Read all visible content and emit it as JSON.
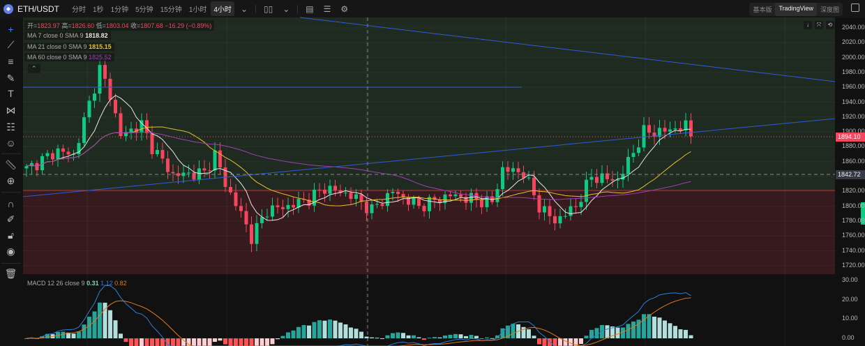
{
  "header": {
    "symbol": "ETH/USDT",
    "timeframes": [
      "分时",
      "1秒",
      "1分钟",
      "5分钟",
      "15分钟",
      "1小时",
      "4小时"
    ],
    "active_timeframe": "4小时",
    "views": [
      "基本版",
      "TradingView",
      "深度图"
    ],
    "active_view": "TradingView"
  },
  "legend": {
    "ohlc": {
      "open_label": "开=",
      "open": "1823.97",
      "high_label": "高=",
      "high": "1826.60",
      "low_label": "低=",
      "low": "1803.04",
      "close_label": "收=",
      "close": "1807.68",
      "change": "−16.29 (−0.89%)"
    },
    "ma": [
      {
        "label": "MA 7 close 0 SMA 9",
        "value": "1818.82",
        "color": "#e8e8e8"
      },
      {
        "label": "MA 21 close 0 SMA 9",
        "value": "1815.15",
        "color": "#e6c229"
      },
      {
        "label": "MA 60 close 0 SMA 9",
        "value": "1825.52",
        "color": "#9c3fb5"
      }
    ],
    "macd": {
      "label": "MACD 12 26 close 9",
      "hist": "0.31",
      "macd": "1.12",
      "signal": "0.82"
    }
  },
  "price_axis": [
    "2040.00",
    "2020.00",
    "2000.00",
    "1980.00",
    "1960.00",
    "1940.00",
    "1920.00",
    "1900.00",
    "1880.00",
    "1860.00",
    "1840.00",
    "1820.00",
    "1800.00",
    "1780.00",
    "1760.00",
    "1740.00",
    "1720.00"
  ],
  "macd_axis": [
    "30.00",
    "20.00",
    "10.00",
    "0.00"
  ],
  "last_price": "1894.10",
  "crosshair_price": "1842.72",
  "colors": {
    "up": "#0ecb81",
    "down": "#f6465d",
    "macd": "#2f7fd6",
    "signal": "#e07a1f"
  },
  "chart_data": {
    "type": "candlestick",
    "ylim": [
      1710,
      2050
    ],
    "candles": 128,
    "keypoints": [
      [
        0,
        1850
      ],
      [
        6,
        1875
      ],
      [
        9,
        1868
      ],
      [
        14,
        1985
      ],
      [
        16,
        1950
      ],
      [
        18,
        1895
      ],
      [
        22,
        1910
      ],
      [
        24,
        1880
      ],
      [
        28,
        1842
      ],
      [
        34,
        1845
      ],
      [
        36,
        1870
      ],
      [
        38,
        1830
      ],
      [
        41,
        1790
      ],
      [
        43,
        1758
      ],
      [
        46,
        1795
      ],
      [
        50,
        1800
      ],
      [
        54,
        1810
      ],
      [
        57,
        1825
      ],
      [
        62,
        1815
      ],
      [
        66,
        1795
      ],
      [
        70,
        1820
      ],
      [
        75,
        1800
      ],
      [
        81,
        1815
      ],
      [
        89,
        1805
      ],
      [
        91,
        1850
      ],
      [
        95,
        1845
      ],
      [
        98,
        1800
      ],
      [
        101,
        1780
      ],
      [
        105,
        1800
      ],
      [
        108,
        1840
      ],
      [
        113,
        1835
      ],
      [
        115,
        1860
      ],
      [
        118,
        1900
      ],
      [
        121,
        1900
      ],
      [
        126,
        1908
      ],
      [
        127,
        1894
      ]
    ]
  }
}
